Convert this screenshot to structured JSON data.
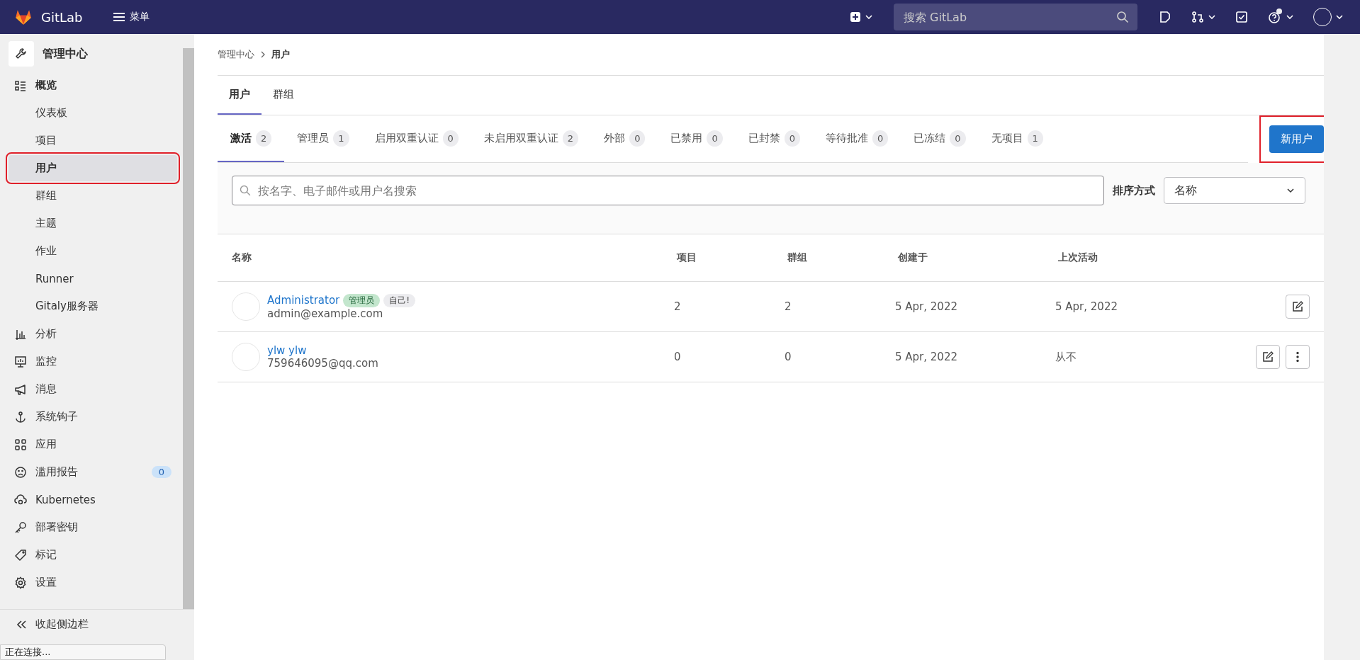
{
  "topbar": {
    "brand": "GitLab",
    "menu_label": "菜单",
    "search": {
      "placeholder": "搜索 GitLab"
    },
    "help_has_notification": true
  },
  "sidebar": {
    "title": "管理中心",
    "items": [
      {
        "label": "概览",
        "selected": false,
        "highlighted": false,
        "children": [
          {
            "label": "仪表板",
            "selected": false,
            "highlighted": false
          },
          {
            "label": "项目",
            "selected": false,
            "highlighted": false
          },
          {
            "label": "用户",
            "selected": true,
            "highlighted": true
          },
          {
            "label": "群组",
            "selected": false,
            "highlighted": false
          },
          {
            "label": "主题",
            "selected": false,
            "highlighted": false
          },
          {
            "label": "作业",
            "selected": false,
            "highlighted": false
          },
          {
            "label": "Runner",
            "selected": false,
            "highlighted": false
          },
          {
            "label": "Gitaly服务器",
            "selected": false,
            "highlighted": false
          }
        ]
      },
      {
        "label": "分析",
        "selected": false,
        "highlighted": false
      },
      {
        "label": "监控",
        "selected": false,
        "highlighted": false
      },
      {
        "label": "消息",
        "selected": false,
        "highlighted": false
      },
      {
        "label": "系统钩子",
        "selected": false,
        "highlighted": false
      },
      {
        "label": "应用",
        "selected": false,
        "highlighted": false
      },
      {
        "label": "滥用报告",
        "selected": false,
        "highlighted": false,
        "count": "0"
      },
      {
        "label": "Kubernetes",
        "selected": false,
        "highlighted": false
      },
      {
        "label": "部署密钥",
        "selected": false,
        "highlighted": false
      },
      {
        "label": "标记",
        "selected": false,
        "highlighted": false
      },
      {
        "label": "设置",
        "selected": false,
        "highlighted": false
      }
    ],
    "collapse_label": "收起侧边栏"
  },
  "breadcrumb": [
    "管理中心",
    "用户"
  ],
  "tabs": [
    {
      "label": "用户",
      "selected": true
    },
    {
      "label": "群组",
      "selected": false
    }
  ],
  "filter_tabs": [
    {
      "label": "激活",
      "count": "2",
      "selected": true
    },
    {
      "label": "管理员",
      "count": "1",
      "selected": false
    },
    {
      "label": "启用双重认证",
      "count": "0",
      "selected": false
    },
    {
      "label": "未启用双重认证",
      "count": "2",
      "selected": false
    },
    {
      "label": "外部",
      "count": "0",
      "selected": false
    },
    {
      "label": "已禁用",
      "count": "0",
      "selected": false
    },
    {
      "label": "已封禁",
      "count": "0",
      "selected": false
    },
    {
      "label": "等待批准",
      "count": "0",
      "selected": false
    },
    {
      "label": "已冻结",
      "count": "0",
      "selected": false
    },
    {
      "label": "无项目",
      "count": "1",
      "selected": false
    }
  ],
  "new_user_button": {
    "label": "新用户",
    "highlighted": true
  },
  "search": {
    "placeholder": "按名字、电子邮件或用户名搜索"
  },
  "sort": {
    "label": "排序方式",
    "value": "名称"
  },
  "table": {
    "columns": [
      "名称",
      "项目",
      "群组",
      "创建于",
      "上次活动"
    ],
    "rows": [
      {
        "name": "Administrator",
        "email": "admin@example.com",
        "badges": [
          {
            "label": "管理员",
            "kind": "admin"
          },
          {
            "label": "自己!",
            "kind": "self"
          }
        ],
        "projects": "2",
        "groups": "2",
        "created": "5 Apr, 2022",
        "last_activity": "5 Apr, 2022",
        "actions": [
          {
            "kind": "edit"
          }
        ]
      },
      {
        "name": "ylw ylw",
        "email": "759646095@qq.com",
        "projects": "0",
        "groups": "0",
        "created": "5 Apr, 2022",
        "last_activity": "从不",
        "actions": [
          {
            "kind": "edit"
          },
          {
            "kind": "more"
          }
        ]
      }
    ]
  },
  "status_popup": "正在连接..."
}
